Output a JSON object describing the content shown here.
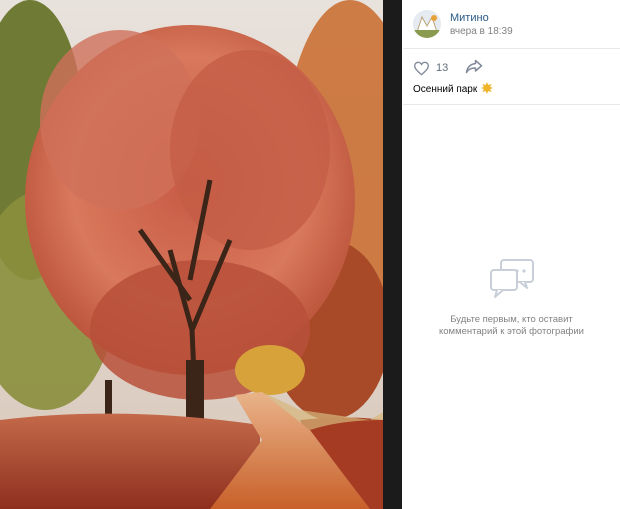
{
  "post": {
    "author_name": "Митино",
    "timestamp": "вчера в 18:39",
    "avatar_icon": "community-avatar",
    "like_icon": "heart-outline-icon",
    "likes_count": "13",
    "share_icon": "share-arrow-icon",
    "caption": "Осенний парк",
    "caption_emoji": "maple-leaf"
  },
  "comments": {
    "empty_icon": "comments-icon",
    "empty_line1": "Будьте первым, кто оставит",
    "empty_line2": "комментарий к этой фотографии"
  },
  "colors": {
    "link": "#2a5885",
    "muted": "#828282",
    "divider": "#e7e8ec",
    "photo_background": "#1b1b1b"
  }
}
